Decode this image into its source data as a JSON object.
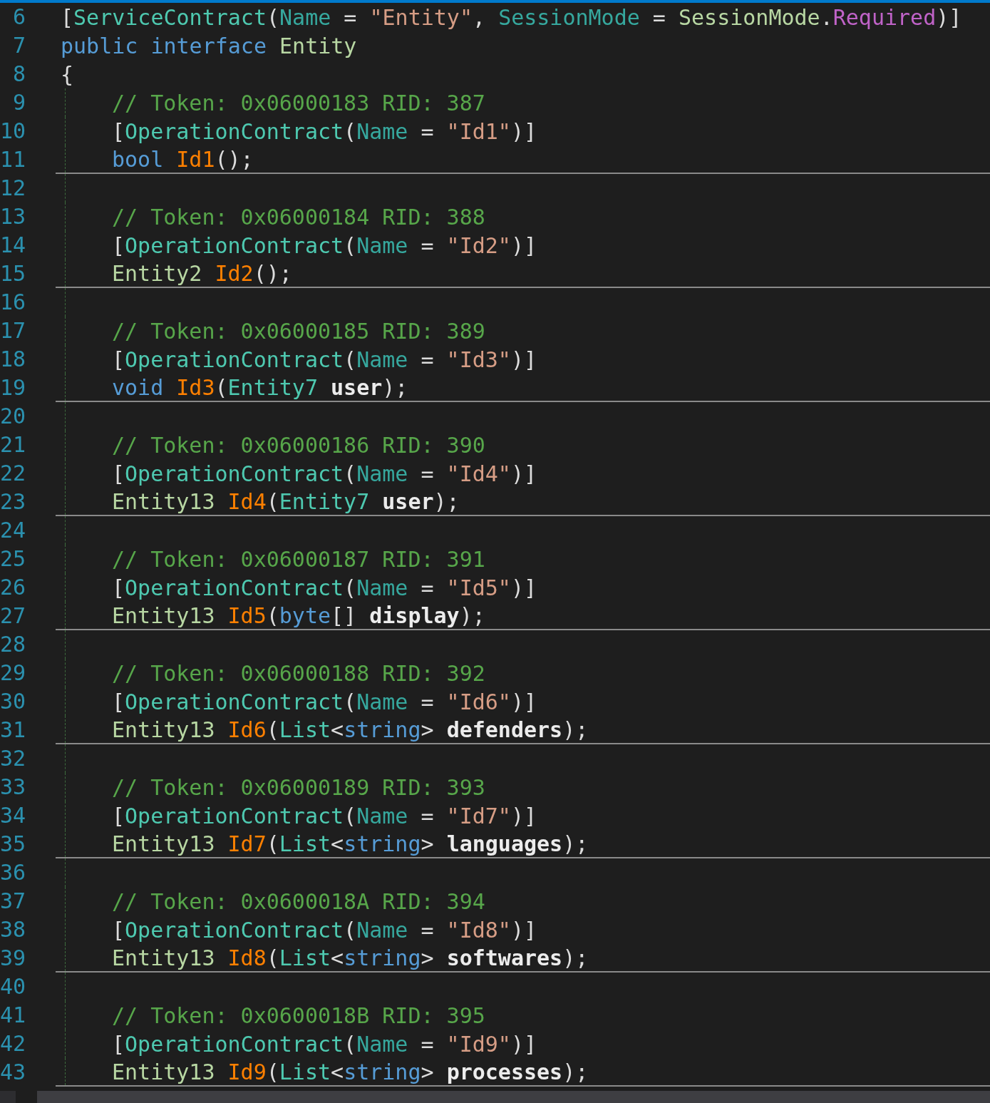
{
  "editor": {
    "header_lines": [
      {
        "number": "6",
        "separator_below": false,
        "tokens": [
          {
            "kind": "punct",
            "text": "["
          },
          {
            "kind": "class",
            "text": "ServiceContract"
          },
          {
            "kind": "punct",
            "text": "("
          },
          {
            "kind": "property",
            "text": "Name"
          },
          {
            "kind": "punct",
            "text": " = "
          },
          {
            "kind": "string",
            "text": "\"Entity\""
          },
          {
            "kind": "punct",
            "text": ", "
          },
          {
            "kind": "property",
            "text": "SessionMode"
          },
          {
            "kind": "punct",
            "text": " = "
          },
          {
            "kind": "enum_type",
            "text": "SessionMode"
          },
          {
            "kind": "punct",
            "text": "."
          },
          {
            "kind": "enum_member",
            "text": "Required"
          },
          {
            "kind": "punct",
            "text": ")]"
          }
        ]
      },
      {
        "number": "7",
        "separator_below": false,
        "tokens": [
          {
            "kind": "keyword",
            "text": "public "
          },
          {
            "kind": "keyword",
            "text": "interface "
          },
          {
            "kind": "interface",
            "text": "Entity"
          }
        ]
      },
      {
        "number": "8",
        "separator_below": false,
        "tokens": [
          {
            "kind": "punct",
            "text": "{"
          }
        ]
      }
    ],
    "body_lines": [
      {
        "number": "9",
        "separator_below": false,
        "tokens": [
          {
            "kind": "comment",
            "text": "// Token: 0x06000183 RID: 387"
          }
        ]
      },
      {
        "number": "10",
        "separator_below": false,
        "tokens": [
          {
            "kind": "punct",
            "text": "["
          },
          {
            "kind": "class",
            "text": "OperationContract"
          },
          {
            "kind": "punct",
            "text": "("
          },
          {
            "kind": "property",
            "text": "Name"
          },
          {
            "kind": "punct",
            "text": " = "
          },
          {
            "kind": "string",
            "text": "\"Id1\""
          },
          {
            "kind": "punct",
            "text": ")]"
          }
        ]
      },
      {
        "number": "11",
        "separator_below": true,
        "tokens": [
          {
            "kind": "keyword",
            "text": "bool "
          },
          {
            "kind": "method",
            "text": "Id1"
          },
          {
            "kind": "punct",
            "text": "();"
          }
        ]
      },
      {
        "number": "12",
        "separator_below": false
      },
      {
        "number": "13",
        "separator_below": false,
        "tokens": [
          {
            "kind": "comment",
            "text": "// Token: 0x06000184 RID: 388"
          }
        ]
      },
      {
        "number": "14",
        "separator_below": false,
        "tokens": [
          {
            "kind": "punct",
            "text": "["
          },
          {
            "kind": "class",
            "text": "OperationContract"
          },
          {
            "kind": "punct",
            "text": "("
          },
          {
            "kind": "property",
            "text": "Name"
          },
          {
            "kind": "punct",
            "text": " = "
          },
          {
            "kind": "string",
            "text": "\"Id2\""
          },
          {
            "kind": "punct",
            "text": ")]"
          }
        ]
      },
      {
        "number": "15",
        "separator_below": true,
        "tokens": [
          {
            "kind": "interface",
            "text": "Entity2 "
          },
          {
            "kind": "method",
            "text": "Id2"
          },
          {
            "kind": "punct",
            "text": "();"
          }
        ]
      },
      {
        "number": "16",
        "separator_below": false
      },
      {
        "number": "17",
        "separator_below": false,
        "tokens": [
          {
            "kind": "comment",
            "text": "// Token: 0x06000185 RID: 389"
          }
        ]
      },
      {
        "number": "18",
        "separator_below": false,
        "tokens": [
          {
            "kind": "punct",
            "text": "["
          },
          {
            "kind": "class",
            "text": "OperationContract"
          },
          {
            "kind": "punct",
            "text": "("
          },
          {
            "kind": "property",
            "text": "Name"
          },
          {
            "kind": "punct",
            "text": " = "
          },
          {
            "kind": "string",
            "text": "\"Id3\""
          },
          {
            "kind": "punct",
            "text": ")]"
          }
        ]
      },
      {
        "number": "19",
        "separator_below": true,
        "tokens": [
          {
            "kind": "keyword",
            "text": "void "
          },
          {
            "kind": "method",
            "text": "Id3"
          },
          {
            "kind": "punct",
            "text": "("
          },
          {
            "kind": "class",
            "text": "Entity7 "
          },
          {
            "kind": "param",
            "text": "user"
          },
          {
            "kind": "punct",
            "text": ");"
          }
        ]
      },
      {
        "number": "20",
        "separator_below": false
      },
      {
        "number": "21",
        "separator_below": false,
        "tokens": [
          {
            "kind": "comment",
            "text": "// Token: 0x06000186 RID: 390"
          }
        ]
      },
      {
        "number": "22",
        "separator_below": false,
        "tokens": [
          {
            "kind": "punct",
            "text": "["
          },
          {
            "kind": "class",
            "text": "OperationContract"
          },
          {
            "kind": "punct",
            "text": "("
          },
          {
            "kind": "property",
            "text": "Name"
          },
          {
            "kind": "punct",
            "text": " = "
          },
          {
            "kind": "string",
            "text": "\"Id4\""
          },
          {
            "kind": "punct",
            "text": ")]"
          }
        ]
      },
      {
        "number": "23",
        "separator_below": true,
        "tokens": [
          {
            "kind": "interface",
            "text": "Entity13 "
          },
          {
            "kind": "method",
            "text": "Id4"
          },
          {
            "kind": "punct",
            "text": "("
          },
          {
            "kind": "class",
            "text": "Entity7 "
          },
          {
            "kind": "param",
            "text": "user"
          },
          {
            "kind": "punct",
            "text": ");"
          }
        ]
      },
      {
        "number": "24",
        "separator_below": false
      },
      {
        "number": "25",
        "separator_below": false,
        "tokens": [
          {
            "kind": "comment",
            "text": "// Token: 0x06000187 RID: 391"
          }
        ]
      },
      {
        "number": "26",
        "separator_below": false,
        "tokens": [
          {
            "kind": "punct",
            "text": "["
          },
          {
            "kind": "class",
            "text": "OperationContract"
          },
          {
            "kind": "punct",
            "text": "("
          },
          {
            "kind": "property",
            "text": "Name"
          },
          {
            "kind": "punct",
            "text": " = "
          },
          {
            "kind": "string",
            "text": "\"Id5\""
          },
          {
            "kind": "punct",
            "text": ")]"
          }
        ]
      },
      {
        "number": "27",
        "separator_below": true,
        "tokens": [
          {
            "kind": "interface",
            "text": "Entity13 "
          },
          {
            "kind": "method",
            "text": "Id5"
          },
          {
            "kind": "punct",
            "text": "("
          },
          {
            "kind": "keyword",
            "text": "byte"
          },
          {
            "kind": "punct",
            "text": "[] "
          },
          {
            "kind": "param",
            "text": "display"
          },
          {
            "kind": "punct",
            "text": ");"
          }
        ]
      },
      {
        "number": "28",
        "separator_below": false
      },
      {
        "number": "29",
        "separator_below": false,
        "tokens": [
          {
            "kind": "comment",
            "text": "// Token: 0x06000188 RID: 392"
          }
        ]
      },
      {
        "number": "30",
        "separator_below": false,
        "tokens": [
          {
            "kind": "punct",
            "text": "["
          },
          {
            "kind": "class",
            "text": "OperationContract"
          },
          {
            "kind": "punct",
            "text": "("
          },
          {
            "kind": "property",
            "text": "Name"
          },
          {
            "kind": "punct",
            "text": " = "
          },
          {
            "kind": "string",
            "text": "\"Id6\""
          },
          {
            "kind": "punct",
            "text": ")]"
          }
        ]
      },
      {
        "number": "31",
        "separator_below": true,
        "tokens": [
          {
            "kind": "interface",
            "text": "Entity13 "
          },
          {
            "kind": "method",
            "text": "Id6"
          },
          {
            "kind": "punct",
            "text": "("
          },
          {
            "kind": "class",
            "text": "List"
          },
          {
            "kind": "punct",
            "text": "<"
          },
          {
            "kind": "keyword",
            "text": "string"
          },
          {
            "kind": "punct",
            "text": "> "
          },
          {
            "kind": "param",
            "text": "defenders"
          },
          {
            "kind": "punct",
            "text": ");"
          }
        ]
      },
      {
        "number": "32",
        "separator_below": false
      },
      {
        "number": "33",
        "separator_below": false,
        "tokens": [
          {
            "kind": "comment",
            "text": "// Token: 0x06000189 RID: 393"
          }
        ]
      },
      {
        "number": "34",
        "separator_below": false,
        "tokens": [
          {
            "kind": "punct",
            "text": "["
          },
          {
            "kind": "class",
            "text": "OperationContract"
          },
          {
            "kind": "punct",
            "text": "("
          },
          {
            "kind": "property",
            "text": "Name"
          },
          {
            "kind": "punct",
            "text": " = "
          },
          {
            "kind": "string",
            "text": "\"Id7\""
          },
          {
            "kind": "punct",
            "text": ")]"
          }
        ]
      },
      {
        "number": "35",
        "separator_below": true,
        "tokens": [
          {
            "kind": "interface",
            "text": "Entity13 "
          },
          {
            "kind": "method",
            "text": "Id7"
          },
          {
            "kind": "punct",
            "text": "("
          },
          {
            "kind": "class",
            "text": "List"
          },
          {
            "kind": "punct",
            "text": "<"
          },
          {
            "kind": "keyword",
            "text": "string"
          },
          {
            "kind": "punct",
            "text": "> "
          },
          {
            "kind": "param",
            "text": "languages"
          },
          {
            "kind": "punct",
            "text": ");"
          }
        ]
      },
      {
        "number": "36",
        "separator_below": false
      },
      {
        "number": "37",
        "separator_below": false,
        "tokens": [
          {
            "kind": "comment",
            "text": "// Token: 0x0600018A RID: 394"
          }
        ]
      },
      {
        "number": "38",
        "separator_below": false,
        "tokens": [
          {
            "kind": "punct",
            "text": "["
          },
          {
            "kind": "class",
            "text": "OperationContract"
          },
          {
            "kind": "punct",
            "text": "("
          },
          {
            "kind": "property",
            "text": "Name"
          },
          {
            "kind": "punct",
            "text": " = "
          },
          {
            "kind": "string",
            "text": "\"Id8\""
          },
          {
            "kind": "punct",
            "text": ")]"
          }
        ]
      },
      {
        "number": "39",
        "separator_below": true,
        "tokens": [
          {
            "kind": "interface",
            "text": "Entity13 "
          },
          {
            "kind": "method",
            "text": "Id8"
          },
          {
            "kind": "punct",
            "text": "("
          },
          {
            "kind": "class",
            "text": "List"
          },
          {
            "kind": "punct",
            "text": "<"
          },
          {
            "kind": "keyword",
            "text": "string"
          },
          {
            "kind": "punct",
            "text": "> "
          },
          {
            "kind": "param",
            "text": "softwares"
          },
          {
            "kind": "punct",
            "text": ");"
          }
        ]
      },
      {
        "number": "40",
        "separator_below": false
      },
      {
        "number": "41",
        "separator_below": false,
        "tokens": [
          {
            "kind": "comment",
            "text": "// Token: 0x0600018B RID: 395"
          }
        ]
      },
      {
        "number": "42",
        "separator_below": false,
        "tokens": [
          {
            "kind": "punct",
            "text": "["
          },
          {
            "kind": "class",
            "text": "OperationContract"
          },
          {
            "kind": "punct",
            "text": "("
          },
          {
            "kind": "property",
            "text": "Name"
          },
          {
            "kind": "punct",
            "text": " = "
          },
          {
            "kind": "string",
            "text": "\"Id9\""
          },
          {
            "kind": "punct",
            "text": ")]"
          }
        ]
      },
      {
        "number": "43",
        "separator_below": true,
        "tokens": [
          {
            "kind": "interface",
            "text": "Entity13 "
          },
          {
            "kind": "method",
            "text": "Id9"
          },
          {
            "kind": "punct",
            "text": "("
          },
          {
            "kind": "class",
            "text": "List"
          },
          {
            "kind": "punct",
            "text": "<"
          },
          {
            "kind": "keyword",
            "text": "string"
          },
          {
            "kind": "punct",
            "text": "> "
          },
          {
            "kind": "param",
            "text": "processes"
          },
          {
            "kind": "punct",
            "text": ");"
          }
        ]
      }
    ]
  }
}
